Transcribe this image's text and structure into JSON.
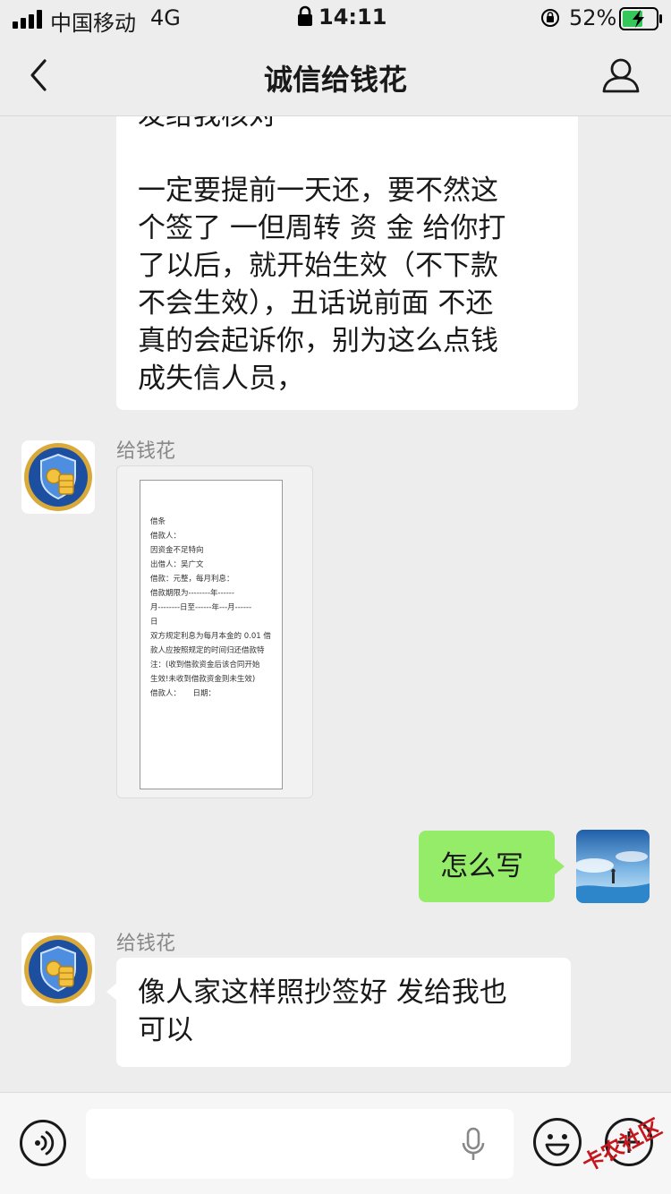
{
  "status_bar": {
    "carrier": "中国移动",
    "network": "4G",
    "time": "14:11",
    "battery": "52%"
  },
  "nav": {
    "title": "诚信给钱花"
  },
  "messages": [
    {
      "sender": "",
      "text_lines": [
        "发给我核对",
        "",
        "一定要提前一天还，要不然这",
        "个签了 一但周转 资 金 给你打",
        "了以后，就开始生效（不下款",
        "不会生效），丑话说前面 不还",
        "真的会起诉你，别为这么点钱",
        "成失信人员，"
      ]
    },
    {
      "sender": "给钱花",
      "document_lines": [
        "借条",
        "借款人：",
        "",
        "因资金不足特向",
        "",
        "出借人：吴广文",
        "",
        "借款：元整，每月利息：",
        "借款期限为--------年------",
        "月--------日至------年---月------",
        "日",
        "",
        "双方规定利息为每月本金的 0.01 借",
        "款人应按照规定的时间归还借款特",
        "注：(收到借款资金后该合同开始",
        "生效!未收到借款资金则未生效)",
        "借款人：     日期："
      ]
    },
    {
      "sender": "me",
      "text": "怎么写"
    },
    {
      "sender": "给钱花",
      "text_lines": [
        "像人家这样照抄签好 发给我也",
        "可以"
      ]
    }
  ],
  "watermark": "卡农社区",
  "colors": {
    "background": "#ededed",
    "outgoing_bubble": "#95ec69",
    "incoming_bubble": "#ffffff",
    "avatar_shield_blue": "#1d4fa0",
    "watermark_red": "#c4161c"
  },
  "icons": [
    "back-icon",
    "profile-icon",
    "lock-icon",
    "rotate-lock-icon",
    "battery-icon",
    "voice-icon",
    "microphone-icon",
    "emoji-icon",
    "plus-icon"
  ]
}
